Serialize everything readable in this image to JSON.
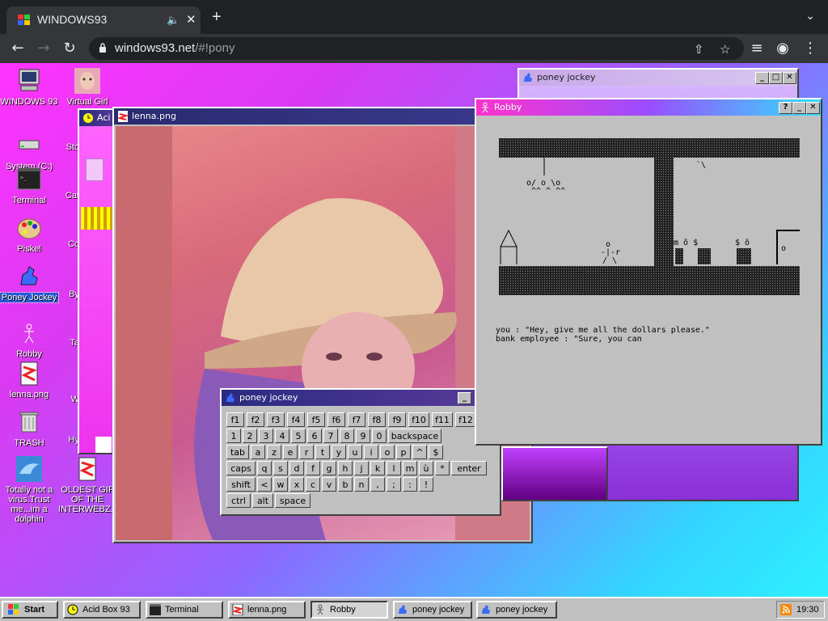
{
  "browser": {
    "tab_title": "WINDOWS93",
    "new_tab": "+",
    "url_host": "windows93.net",
    "url_rest": "/#!pony"
  },
  "desktop_icons": [
    {
      "label": "WINDOWS 93"
    },
    {
      "label": "Virtual Girl"
    },
    {
      "label": "System (C:)"
    },
    {
      "label": "Terminal"
    },
    {
      "label": "Piskel"
    },
    {
      "label": "Poney Jockey"
    },
    {
      "label": "Robby"
    },
    {
      "label": "lenna.png"
    },
    {
      "label": "TRASH"
    },
    {
      "label": "Totally not a virus.Trust me...im a dolphin"
    },
    {
      "label": "OLDEST GIF OF THE INTERWEBZ.gif"
    }
  ],
  "partial_icon_labels": [
    "Sto",
    "Cat",
    "Co",
    "By",
    "Ta",
    "W",
    "Hy"
  ],
  "windows": {
    "acid": {
      "title": "Aci"
    },
    "lenna": {
      "title": "lenna.png"
    },
    "pony_back": {
      "title": "poney jockey"
    },
    "robby": {
      "title": "Robby",
      "help": "?",
      "dialogue": [
        "you : \"Hey, give me all the dollars please.\"",
        "bank employee : \"Sure, you can"
      ]
    },
    "pony_keys": {
      "title": "poney jockey",
      "rows": [
        [
          "f1",
          "f2",
          "f3",
          "f4",
          "f5",
          "f6",
          "f7",
          "f8",
          "f9",
          "f10",
          "f11",
          "f12"
        ],
        [
          "1",
          "2",
          "3",
          "4",
          "5",
          "6",
          "7",
          "8",
          "9",
          "0",
          "backspace"
        ],
        [
          "tab",
          "a",
          "z",
          "e",
          "r",
          "t",
          "y",
          "u",
          "i",
          "o",
          "p",
          "^",
          "$"
        ],
        [
          "caps",
          "q",
          "s",
          "d",
          "f",
          "g",
          "h",
          "j",
          "k",
          "l",
          "m",
          "ù",
          "*",
          "enter"
        ],
        [
          "shift",
          "<",
          "w",
          "x",
          "c",
          "v",
          "b",
          "n",
          ",",
          ";",
          ":",
          "!"
        ],
        [
          "ctrl",
          "alt",
          "space"
        ]
      ]
    }
  },
  "taskbar": {
    "start": "Start",
    "items": [
      "Acid Box 93",
      "Terminal",
      "lenna.png",
      "Robby",
      "poney jockey",
      "poney jockey"
    ],
    "clock": "19:30"
  },
  "colors": {
    "desktop_start": "#ff33ff",
    "desktop_end": "#2ef0ff",
    "titlebar": "#2a2a80"
  }
}
